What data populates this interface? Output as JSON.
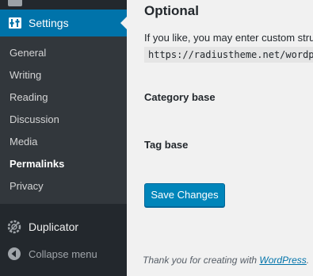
{
  "sidebar": {
    "settings_label": "Settings",
    "submenu": [
      "General",
      "Writing",
      "Reading",
      "Discussion",
      "Media",
      "Permalinks",
      "Privacy"
    ],
    "current_submenu": "Permalinks",
    "duplicator_label": "Duplicator",
    "collapse_label": "Collapse menu",
    "icons": [
      "settings-icon",
      "duplicator-icon",
      "collapse-icon"
    ]
  },
  "main": {
    "section_title": "Optional",
    "intro_text": "If you like, you may enter custom structures for your category and tag URLs here.",
    "code_sample": "https://radiustheme.net/wordpress/category/uncategorized/",
    "category_base_label": "Category base",
    "tag_base_label": "Tag base",
    "save_button_label": "Save Changes",
    "footer_text": "Thank you for creating with ",
    "footer_link": "WordPress",
    "footer_suffix": "."
  },
  "colors": {
    "sidebar_bg": "#23282d",
    "submenu_bg": "#32373c",
    "active_bg": "#0073aa",
    "button_bg": "#0085ba",
    "page_bg": "#f1f1f1"
  }
}
